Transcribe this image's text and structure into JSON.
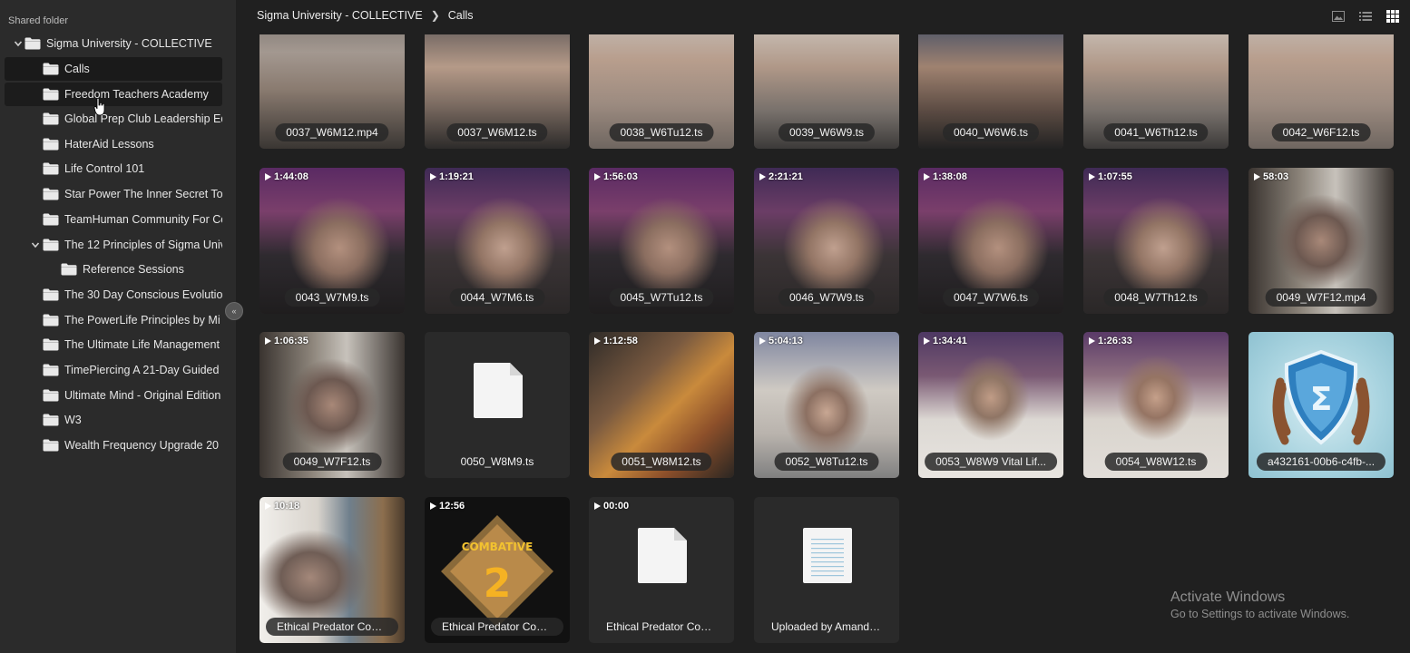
{
  "sidebar": {
    "heading": "Shared folder",
    "items": [
      {
        "label": "Sigma University - COLLECTIVE",
        "expanded": true
      },
      {
        "label": "Calls",
        "selected": true
      },
      {
        "label": "Freedom Teachers Academy",
        "hovered": true
      },
      {
        "label": "Global Prep Club Leadership Ed"
      },
      {
        "label": "HaterAid Lessons"
      },
      {
        "label": "Life Control 101"
      },
      {
        "label": "Star Power The Inner Secret To"
      },
      {
        "label": "TeamHuman Community For Co"
      },
      {
        "label": "The 12 Principles of Sigma Unive",
        "expanded": true
      },
      {
        "label": "Reference Sessions"
      },
      {
        "label": "The 30 Day Conscious Evolution"
      },
      {
        "label": "The PowerLife Principles by Mi"
      },
      {
        "label": "The Ultimate Life Management"
      },
      {
        "label": "TimePiercing A 21-Day Guided"
      },
      {
        "label": "Ultimate Mind - Original Edition"
      },
      {
        "label": "W3"
      },
      {
        "label": "Wealth Frequency Upgrade 20"
      }
    ],
    "collapse_icon": "double-chevron-left-icon"
  },
  "breadcrumb": {
    "root": "Sigma University - COLLECTIVE",
    "current": "Calls"
  },
  "view_modes": [
    "image-view-icon",
    "list-view-icon",
    "grid-view-icon"
  ],
  "active_view": "grid",
  "tiles": [
    {
      "name": "0037_W6M12.mp4",
      "duration": "",
      "thumb": "v1"
    },
    {
      "name": "0037_W6M12.ts",
      "duration": "",
      "thumb": "v2"
    },
    {
      "name": "0038_W6Tu12.ts",
      "duration": "",
      "thumb": "v3"
    },
    {
      "name": "0039_W6W9.ts",
      "duration": "",
      "thumb": "v5"
    },
    {
      "name": "0040_W6W6.ts",
      "duration": "",
      "thumb": "v4"
    },
    {
      "name": "0041_W6Th12.ts",
      "duration": "",
      "thumb": "v5"
    },
    {
      "name": "0042_W6F12.ts",
      "duration": "",
      "thumb": "v3"
    },
    {
      "name": "0043_W7M9.ts",
      "duration": "1:44:08",
      "thumb": "p"
    },
    {
      "name": "0044_W7M6.ts",
      "duration": "1:19:21",
      "thumb": "p2"
    },
    {
      "name": "0045_W7Tu12.ts",
      "duration": "1:56:03",
      "thumb": "p"
    },
    {
      "name": "0046_W7W9.ts",
      "duration": "2:21:21",
      "thumb": "p2"
    },
    {
      "name": "0047_W7W6.ts",
      "duration": "1:38:08",
      "thumb": "p"
    },
    {
      "name": "0048_W7Th12.ts",
      "duration": "1:07:55",
      "thumb": "p2"
    },
    {
      "name": "0049_W7F12.mp4",
      "duration": "58:03",
      "thumb": "room"
    },
    {
      "name": "0049_W7F12.ts",
      "duration": "1:06:35",
      "thumb": "room"
    },
    {
      "name": "0050_W8M9.ts",
      "duration": "",
      "thumb": "file"
    },
    {
      "name": "0051_W8M12.ts",
      "duration": "1:12:58",
      "thumb": "kitchen"
    },
    {
      "name": "0052_W8Tu12.ts",
      "duration": "5:04:13",
      "thumb": "window"
    },
    {
      "name": "0053_W8W9 Vital Lif...",
      "duration": "1:34:41",
      "thumb": "hoodie"
    },
    {
      "name": "0054_W8W12.ts",
      "duration": "1:26:33",
      "thumb": "hoodie2"
    },
    {
      "name": "a432161-00b6-c4fb-...",
      "duration": "",
      "thumb": "emblem"
    },
    {
      "name": "Ethical Predator Com...",
      "duration": "10:18",
      "thumb": "office"
    },
    {
      "name": "Ethical Predator Com...",
      "duration": "12:56",
      "thumb": "combat",
      "badge_text": "COMBATIVE",
      "badge_number": "2"
    },
    {
      "name": "Ethical Predator Com...",
      "duration": "00:00",
      "thumb": "file"
    },
    {
      "name": "Uploaded by Amanda ...",
      "duration": "",
      "thumb": "textfile"
    }
  ],
  "watermark": {
    "title": "Activate Windows",
    "subtitle": "Go to Settings to activate Windows."
  },
  "colors": {
    "background": "#202020",
    "sidebar": "#2b2b2b",
    "selected_row": "#1a1a1a",
    "accent_active_view": "#ffffff"
  }
}
